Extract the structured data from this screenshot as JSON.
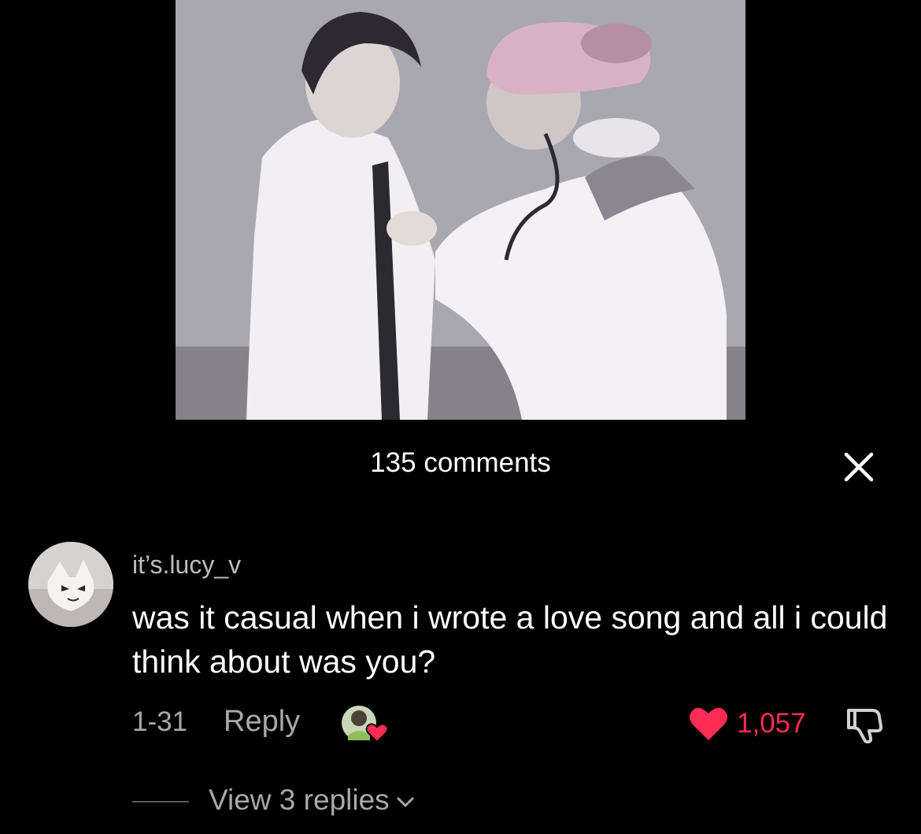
{
  "comments_header": {
    "count_label": "135 comments"
  },
  "close_button": {
    "icon": "close-icon"
  },
  "comment": {
    "username": "it’s.lucy_v",
    "text": "was it casual when i wrote a love song and all i could think about was you?",
    "date": "1-31",
    "reply_label": "Reply",
    "likes": "1,057",
    "liked_by_creator": true,
    "liked": true,
    "view_replies_label": "View 3 replies"
  },
  "colors": {
    "background": "#000000",
    "like_red": "#fe2c55",
    "secondary_text": "#a8a8a8",
    "username_text": "#bdbdbd"
  }
}
